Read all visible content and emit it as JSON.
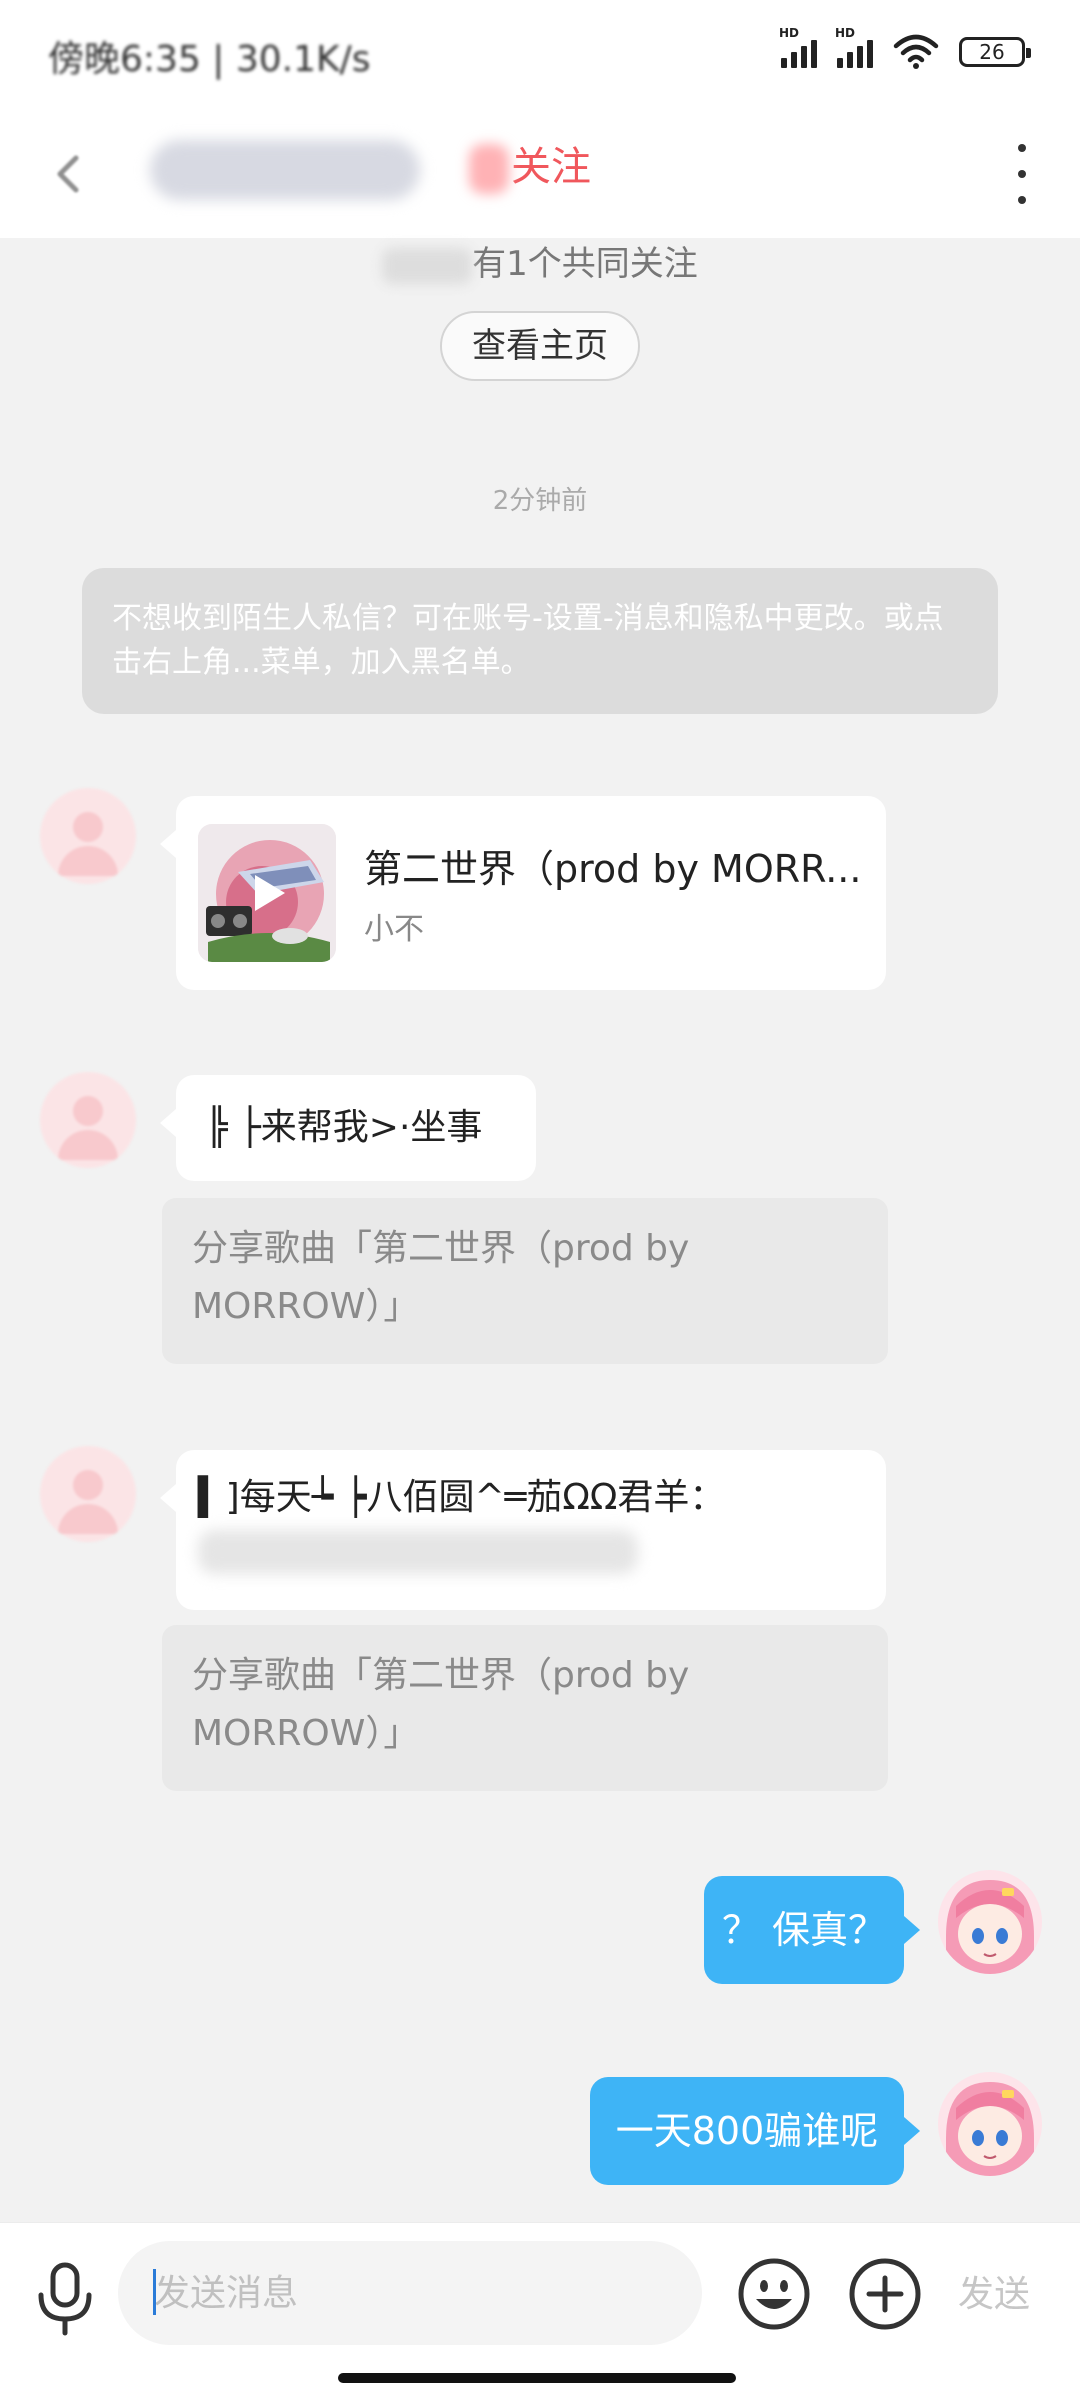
{
  "status_bar": {
    "time": "傍晚6:35 | 30.1K/s",
    "signal_1_label": "HD",
    "signal_2_label": "HD",
    "battery": "26"
  },
  "header": {
    "follow_label": "关注"
  },
  "info": {
    "mutual_follow": "有1个共同关注",
    "view_profile": "查看主页"
  },
  "timestamp": "2分钟前",
  "notice": "不想收到陌生人私信？可在账号-设置-消息和隐私中更改。或点击右上角...菜单，加入黑名单。",
  "messages": [
    {
      "type": "music",
      "title": "第二世界（prod by MORR...",
      "artist": "小不"
    },
    {
      "type": "text",
      "text": "╠ ├来帮我>·坐事"
    },
    {
      "type": "share",
      "text": "分享歌曲「第二世界（prod by MORROW）」"
    },
    {
      "type": "text",
      "text": "▍]每天┶ ┝八佰圆^═茄ΩΩ君羊："
    },
    {
      "type": "share",
      "text": "分享歌曲「第二世界（prod by MORROW）」"
    },
    {
      "type": "self_text",
      "text": "？ 保真？"
    },
    {
      "type": "self_text",
      "text": "一天800骗谁呢"
    }
  ],
  "input": {
    "placeholder": "发送消息",
    "send_label": "发送"
  },
  "colors": {
    "accent_blue": "#3eb4f6",
    "follow_red": "#f0575c",
    "background": "#f2f2f2"
  },
  "icons": [
    "back-arrow-icon",
    "more-vertical-icon",
    "mic-icon",
    "emoji-icon",
    "plus-circle-icon",
    "play-icon"
  ]
}
